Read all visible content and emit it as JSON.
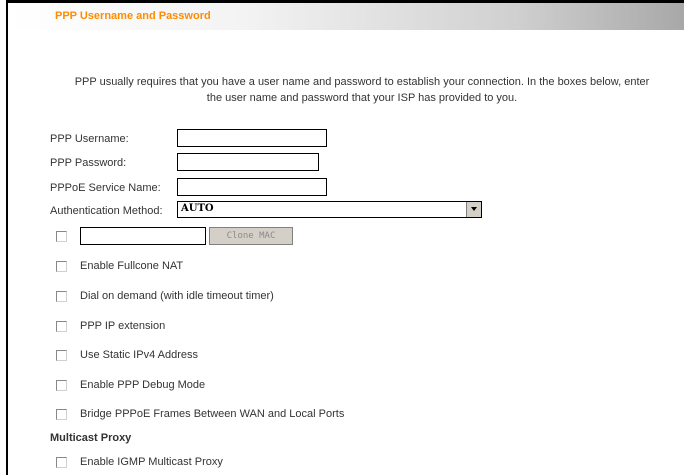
{
  "header": {
    "title": "PPP Username and Password"
  },
  "intro": {
    "line1": "PPP usually requires that you have a user name and password to establish your connection. In the boxes below, enter",
    "line2": "the user name and password that your ISP has provided to you."
  },
  "form": {
    "username_label": "PPP Username:",
    "username_value": "",
    "password_label": "PPP Password:",
    "password_value": "",
    "service_label": "PPPoE Service Name:",
    "service_value": "",
    "auth_label": "Authentication Method:",
    "auth_value": "AUTO",
    "mac_value": "",
    "clone_mac_label": "Clone MAC"
  },
  "options": [
    "Enable Fullcone NAT",
    "Dial on demand (with idle timeout timer)",
    "PPP IP extension",
    "Use Static IPv4 Address",
    "Enable PPP Debug Mode",
    "Bridge PPPoE Frames Between WAN and Local Ports"
  ],
  "multicast": {
    "title": "Multicast Proxy",
    "igmp_label": "Enable IGMP Multicast Proxy"
  }
}
